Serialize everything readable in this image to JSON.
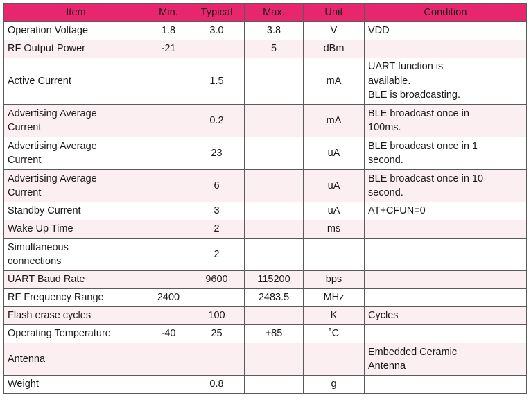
{
  "table": {
    "headers": [
      "Item",
      "Min.",
      "Typical",
      "Max.",
      "Unit",
      "Condition"
    ],
    "colors": {
      "header_background": "#E8266E",
      "header_text": "#FFFFFF",
      "row_alt_background": "#FCEFF1",
      "row_background": "#FFFFFF",
      "border": "#5A5A5A"
    },
    "rows": [
      {
        "item": "Operation Voltage",
        "min": "1.8",
        "typical": "3.0",
        "max": "3.8",
        "unit": "V",
        "condition": "VDD",
        "condition_lines": [
          "VDD"
        ],
        "height": "h1",
        "shade": "odd"
      },
      {
        "item": "RF Output Power",
        "min": "-21",
        "typical": "",
        "max": "5",
        "unit": "dBm",
        "condition": "",
        "condition_lines": [],
        "height": "h1",
        "shade": "even"
      },
      {
        "item": "Active Current",
        "min": "",
        "typical": "1.5",
        "max": "",
        "unit": "mA",
        "condition": "UART function is available. BLE is broadcasting.",
        "condition_lines": [
          "UART function is",
          "available.",
          "BLE is broadcasting."
        ],
        "height": "h3",
        "shade": "odd"
      },
      {
        "item": "Advertising Average Current",
        "item_lines": [
          "Advertising Average",
          "Current"
        ],
        "min": "",
        "typical": "0.2",
        "max": "",
        "unit": "mA",
        "condition": "BLE broadcast once in 100ms.",
        "condition_lines": [
          "BLE broadcast once in",
          "100ms."
        ],
        "height": "h2",
        "shade": "even"
      },
      {
        "item": "Advertising Average Current",
        "item_lines": [
          "Advertising Average",
          "Current"
        ],
        "min": "",
        "typical": "23",
        "max": "",
        "unit": "uA",
        "condition": "BLE broadcast once in 1 second.",
        "condition_lines": [
          "BLE broadcast once in 1",
          "second."
        ],
        "height": "h2",
        "shade": "odd"
      },
      {
        "item": "Advertising Average Current",
        "item_lines": [
          "Advertising Average",
          "Current"
        ],
        "min": "",
        "typical": "6",
        "max": "",
        "unit": "uA",
        "condition": "BLE broadcast once in 10 second.",
        "condition_lines": [
          "BLE broadcast once in 10",
          "second."
        ],
        "height": "h2",
        "shade": "even"
      },
      {
        "item": "Standby Current",
        "min": "",
        "typical": "3",
        "max": "",
        "unit": "uA",
        "condition": "AT+CFUN=0",
        "condition_lines": [
          "AT+CFUN=0"
        ],
        "height": "h1",
        "shade": "odd"
      },
      {
        "item": "Wake Up Time",
        "min": "",
        "typical": "2",
        "max": "",
        "unit": "ms",
        "condition": "",
        "condition_lines": [],
        "height": "h1",
        "shade": "even"
      },
      {
        "item": "Simultaneous connections",
        "item_lines": [
          "Simultaneous",
          "connections"
        ],
        "min": "",
        "typical": "2",
        "max": "",
        "unit": "",
        "condition": "",
        "condition_lines": [],
        "height": "h2",
        "shade": "odd"
      },
      {
        "item": "UART Baud Rate",
        "min": "",
        "typical": "9600",
        "max": "115200",
        "unit": "bps",
        "condition": "",
        "condition_lines": [],
        "height": "h1",
        "shade": "even"
      },
      {
        "item": "RF Frequency Range",
        "min": "2400",
        "typical": "",
        "max": "2483.5",
        "unit": "MHz",
        "condition": "",
        "condition_lines": [],
        "height": "h1",
        "shade": "odd"
      },
      {
        "item": "Flash erase cycles",
        "min": "",
        "typical": "100",
        "max": "",
        "unit": "K",
        "condition": "Cycles",
        "condition_lines": [
          "Cycles"
        ],
        "height": "h1",
        "shade": "even"
      },
      {
        "item": "Operating Temperature",
        "min": "-40",
        "typical": "25",
        "max": "+85",
        "unit": "˚C",
        "condition": "",
        "condition_lines": [],
        "height": "h1",
        "shade": "odd"
      },
      {
        "item": "Antenna",
        "min": "",
        "typical": "",
        "max": "",
        "unit": "",
        "condition": "Embedded Ceramic Antenna",
        "condition_lines": [
          "Embedded Ceramic",
          "Antenna"
        ],
        "height": "h2",
        "shade": "even"
      },
      {
        "item": "Weight",
        "min": "",
        "typical": "0.8",
        "max": "",
        "unit": "g",
        "condition": "",
        "condition_lines": [],
        "height": "h1",
        "shade": "odd"
      }
    ]
  }
}
